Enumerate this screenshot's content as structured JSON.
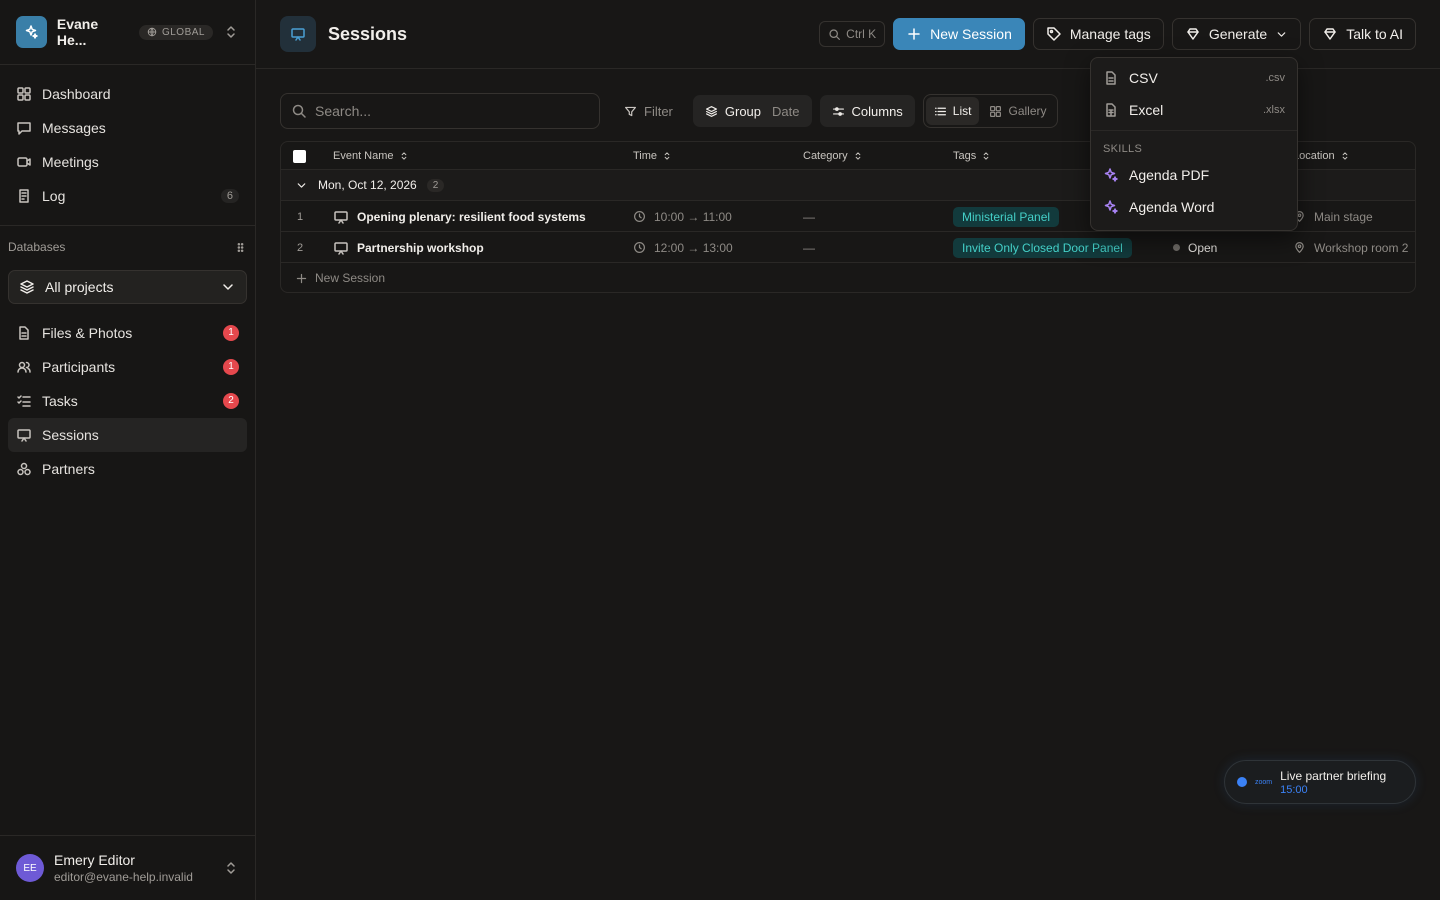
{
  "workspace": {
    "name": "Evane He...",
    "badge": "GLOBAL"
  },
  "nav": [
    {
      "label": "Dashboard",
      "icon": "dashboard-icon",
      "count": ""
    },
    {
      "label": "Messages",
      "icon": "message-icon",
      "count": ""
    },
    {
      "label": "Meetings",
      "icon": "video-icon",
      "count": ""
    },
    {
      "label": "Log",
      "icon": "log-icon",
      "count": "6"
    }
  ],
  "databases": {
    "title": "Databases",
    "project_select": "All projects",
    "items": [
      {
        "label": "Files & Photos",
        "icon": "file-icon",
        "count": "1"
      },
      {
        "label": "Participants",
        "icon": "users-icon",
        "count": "1"
      },
      {
        "label": "Tasks",
        "icon": "tasks-icon",
        "count": "2"
      },
      {
        "label": "Sessions",
        "icon": "presentation-icon",
        "count": ""
      },
      {
        "label": "Partners",
        "icon": "partners-icon",
        "count": ""
      }
    ]
  },
  "user": {
    "initials": "EE",
    "name": "Emery Editor",
    "email": "editor@evane-help.invalid"
  },
  "page": {
    "title": "Sessions"
  },
  "topbar": {
    "shortcut": "Ctrl K",
    "new_session": "New Session",
    "manage_tags": "Manage tags",
    "generate": "Generate",
    "talk_to_ai": "Talk to AI"
  },
  "toolbar": {
    "search_placeholder": "Search...",
    "filter": "Filter",
    "group": "Group",
    "group_value": "Date",
    "columns": "Columns",
    "list": "List",
    "gallery": "Gallery"
  },
  "table": {
    "columns": [
      "Event Name",
      "Time",
      "Category",
      "Tags",
      "Location"
    ],
    "group": {
      "label": "Mon, Oct 12, 2026",
      "count": "2"
    },
    "rows": [
      {
        "num": "1",
        "name": "Opening plenary: resilient food systems",
        "time": "10:00 → 11:00",
        "category": "—",
        "tag": "Ministerial Panel",
        "status": "",
        "location": "Main stage"
      },
      {
        "num": "2",
        "name": "Partnership workshop",
        "time": "12:00 → 13:00",
        "category": "—",
        "tag": "Invite Only Closed Door Panel",
        "status": "Open",
        "location": "Workshop room 2"
      }
    ],
    "new_row": "New Session"
  },
  "dropdown": {
    "items": [
      {
        "label": "CSV",
        "ext": ".csv"
      },
      {
        "label": "Excel",
        "ext": ".xlsx"
      }
    ],
    "skills_label": "SKILLS",
    "skills": [
      {
        "label": "Agenda PDF"
      },
      {
        "label": "Agenda Word"
      }
    ]
  },
  "toast": {
    "brand": "zoom",
    "title": "Live partner briefing",
    "time": "15:00"
  }
}
